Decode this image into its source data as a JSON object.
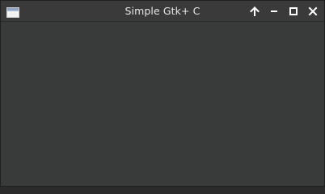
{
  "window": {
    "title": "Simple Gtk+ C"
  },
  "titlebar": {
    "app_icon": "window-icon",
    "buttons": [
      {
        "name": "shade-up-button",
        "icon": "arrow-up-icon"
      },
      {
        "name": "minimize-button",
        "icon": "minimize-icon"
      },
      {
        "name": "maximize-button",
        "icon": "maximize-icon"
      },
      {
        "name": "close-button",
        "icon": "close-icon"
      }
    ]
  },
  "colors": {
    "titlebar_bg": "#3a3a3a",
    "client_bg": "#383b3a",
    "title_text": "#e6e6e6",
    "control_icon": "#ffffff"
  }
}
